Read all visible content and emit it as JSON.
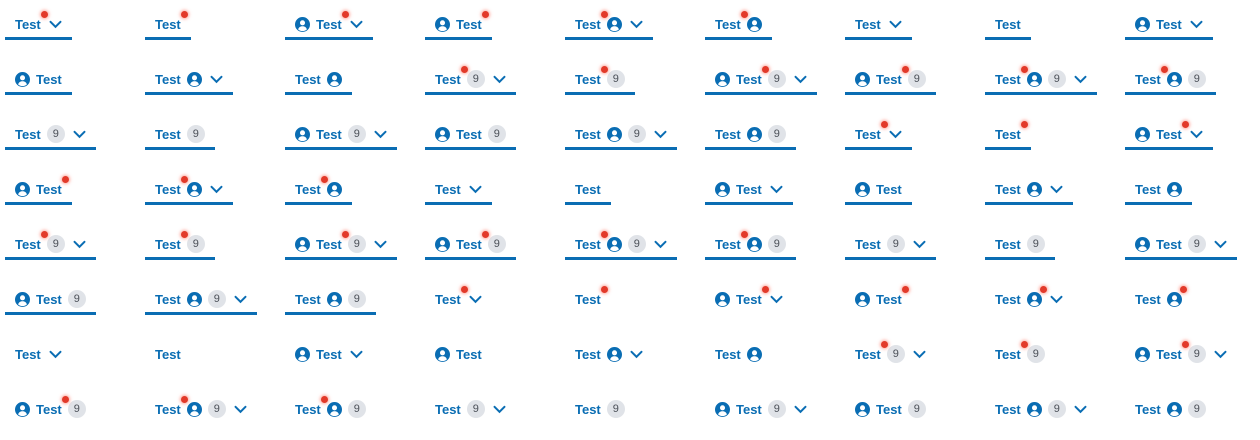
{
  "colors": {
    "accent": "#0a6db3",
    "dot": "#e23a2a",
    "badge_bg": "#e0e3e8",
    "badge_text": "#4a4f57"
  },
  "icons": {
    "avatar": "user-circle-icon",
    "dropdown": "chevron-down-icon",
    "notification": "notification-dot"
  },
  "rows": [
    [
      {
        "label": "Test",
        "selected": true,
        "dot": "label",
        "avatar": false,
        "badge": null,
        "chevron": true
      },
      {
        "label": "Test",
        "selected": true,
        "dot": "label",
        "avatar": false,
        "badge": null,
        "chevron": false
      },
      {
        "label": "Test",
        "selected": true,
        "dot": "label",
        "avatar": "before",
        "badge": null,
        "chevron": true
      },
      {
        "label": "Test",
        "selected": true,
        "dot": "label",
        "avatar": "before",
        "badge": null,
        "chevron": false
      },
      {
        "label": "Test",
        "selected": true,
        "dot": "label",
        "avatar": "after",
        "badge": null,
        "chevron": true
      },
      {
        "label": "Test",
        "selected": true,
        "dot": "label",
        "avatar": "after",
        "badge": null,
        "chevron": false
      },
      {
        "label": "Test",
        "selected": true,
        "dot": null,
        "avatar": false,
        "badge": null,
        "chevron": true
      },
      {
        "label": "Test",
        "selected": true,
        "dot": null,
        "avatar": false,
        "badge": null,
        "chevron": false
      },
      {
        "label": "Test",
        "selected": true,
        "dot": null,
        "avatar": "before",
        "badge": null,
        "chevron": true
      }
    ],
    [
      {
        "label": "Test",
        "selected": true,
        "dot": null,
        "avatar": "before",
        "badge": null,
        "chevron": false
      },
      {
        "label": "Test",
        "selected": true,
        "dot": null,
        "avatar": "after",
        "badge": null,
        "chevron": true
      },
      {
        "label": "Test",
        "selected": true,
        "dot": null,
        "avatar": "after",
        "badge": null,
        "chevron": false
      },
      {
        "label": "Test",
        "selected": true,
        "dot": "label",
        "avatar": false,
        "badge": "9",
        "chevron": true
      },
      {
        "label": "Test",
        "selected": true,
        "dot": "label",
        "avatar": false,
        "badge": "9",
        "chevron": false
      },
      {
        "label": "Test",
        "selected": true,
        "dot": "label",
        "avatar": "before",
        "badge": "9",
        "chevron": true
      },
      {
        "label": "Test",
        "selected": true,
        "dot": "label",
        "avatar": "before",
        "badge": "9",
        "chevron": false
      },
      {
        "label": "Test",
        "selected": true,
        "dot": "label",
        "avatar": "after",
        "badge": "9",
        "chevron": true
      },
      {
        "label": "Test",
        "selected": true,
        "dot": "label",
        "avatar": "after",
        "badge": "9",
        "chevron": false
      }
    ],
    [
      {
        "label": "Test",
        "selected": true,
        "dot": null,
        "avatar": false,
        "badge": "9",
        "chevron": true
      },
      {
        "label": "Test",
        "selected": true,
        "dot": null,
        "avatar": false,
        "badge": "9",
        "chevron": false
      },
      {
        "label": "Test",
        "selected": true,
        "dot": null,
        "avatar": "before",
        "badge": "9",
        "chevron": true
      },
      {
        "label": "Test",
        "selected": true,
        "dot": null,
        "avatar": "before",
        "badge": "9",
        "chevron": false
      },
      {
        "label": "Test",
        "selected": true,
        "dot": null,
        "avatar": "after",
        "badge": "9",
        "chevron": true
      },
      {
        "label": "Test",
        "selected": true,
        "dot": null,
        "avatar": "after",
        "badge": "9",
        "chevron": false
      },
      {
        "label": "Test",
        "selected": true,
        "dot": "label",
        "avatar": false,
        "badge": null,
        "chevron": true
      },
      {
        "label": "Test",
        "selected": true,
        "dot": "label",
        "avatar": false,
        "badge": null,
        "chevron": false
      },
      {
        "label": "Test",
        "selected": true,
        "dot": "label",
        "avatar": "before",
        "badge": null,
        "chevron": true
      }
    ],
    [
      {
        "label": "Test",
        "selected": true,
        "dot": "label",
        "avatar": "before",
        "badge": null,
        "chevron": false
      },
      {
        "label": "Test",
        "selected": true,
        "dot": "label",
        "avatar": "after",
        "badge": null,
        "chevron": true
      },
      {
        "label": "Test",
        "selected": true,
        "dot": "label",
        "avatar": "after",
        "badge": null,
        "chevron": false
      },
      {
        "label": "Test",
        "selected": true,
        "dot": null,
        "avatar": false,
        "badge": null,
        "chevron": true
      },
      {
        "label": "Test",
        "selected": true,
        "dot": null,
        "avatar": false,
        "badge": null,
        "chevron": false
      },
      {
        "label": "Test",
        "selected": true,
        "dot": null,
        "avatar": "before",
        "badge": null,
        "chevron": true
      },
      {
        "label": "Test",
        "selected": true,
        "dot": null,
        "avatar": "before",
        "badge": null,
        "chevron": false
      },
      {
        "label": "Test",
        "selected": true,
        "dot": null,
        "avatar": "after",
        "badge": null,
        "chevron": true
      },
      {
        "label": "Test",
        "selected": true,
        "dot": null,
        "avatar": "after",
        "badge": null,
        "chevron": false
      }
    ],
    [
      {
        "label": "Test",
        "selected": true,
        "dot": "label",
        "avatar": false,
        "badge": "9",
        "chevron": true
      },
      {
        "label": "Test",
        "selected": true,
        "dot": "label",
        "avatar": false,
        "badge": "9",
        "chevron": false
      },
      {
        "label": "Test",
        "selected": true,
        "dot": "label",
        "avatar": "before",
        "badge": "9",
        "chevron": true
      },
      {
        "label": "Test",
        "selected": true,
        "dot": "label",
        "avatar": "before",
        "badge": "9",
        "chevron": false
      },
      {
        "label": "Test",
        "selected": true,
        "dot": "label",
        "avatar": "after",
        "badge": "9",
        "chevron": true
      },
      {
        "label": "Test",
        "selected": true,
        "dot": "label",
        "avatar": "after",
        "badge": "9",
        "chevron": false
      },
      {
        "label": "Test",
        "selected": true,
        "dot": null,
        "avatar": false,
        "badge": "9",
        "chevron": true
      },
      {
        "label": "Test",
        "selected": true,
        "dot": null,
        "avatar": false,
        "badge": "9",
        "chevron": false
      },
      {
        "label": "Test",
        "selected": true,
        "dot": null,
        "avatar": "before",
        "badge": "9",
        "chevron": true
      }
    ],
    [
      {
        "label": "Test",
        "selected": true,
        "dot": null,
        "avatar": "before",
        "badge": "9",
        "chevron": false
      },
      {
        "label": "Test",
        "selected": true,
        "dot": null,
        "avatar": "after",
        "badge": "9",
        "chevron": true
      },
      {
        "label": "Test",
        "selected": true,
        "dot": null,
        "avatar": "after",
        "badge": "9",
        "chevron": false
      },
      {
        "label": "Test",
        "selected": false,
        "dot": "label",
        "avatar": false,
        "badge": null,
        "chevron": true
      },
      {
        "label": "Test",
        "selected": false,
        "dot": "label",
        "avatar": false,
        "badge": null,
        "chevron": false
      },
      {
        "label": "Test",
        "selected": false,
        "dot": "label",
        "avatar": "before",
        "badge": null,
        "chevron": true
      },
      {
        "label": "Test",
        "selected": false,
        "dot": "label",
        "avatar": "before",
        "badge": null,
        "chevron": false
      },
      {
        "label": "Test",
        "selected": false,
        "dot": "avatar",
        "avatar": "after",
        "badge": null,
        "chevron": true
      },
      {
        "label": "Test",
        "selected": false,
        "dot": "avatar",
        "avatar": "after",
        "badge": null,
        "chevron": false
      }
    ],
    [
      {
        "label": "Test",
        "selected": false,
        "dot": null,
        "avatar": false,
        "badge": null,
        "chevron": true
      },
      {
        "label": "Test",
        "selected": false,
        "dot": null,
        "avatar": false,
        "badge": null,
        "chevron": false
      },
      {
        "label": "Test",
        "selected": false,
        "dot": null,
        "avatar": "before",
        "badge": null,
        "chevron": true
      },
      {
        "label": "Test",
        "selected": false,
        "dot": null,
        "avatar": "before",
        "badge": null,
        "chevron": false
      },
      {
        "label": "Test",
        "selected": false,
        "dot": null,
        "avatar": "after",
        "badge": null,
        "chevron": true
      },
      {
        "label": "Test",
        "selected": false,
        "dot": null,
        "avatar": "after",
        "badge": null,
        "chevron": false
      },
      {
        "label": "Test",
        "selected": false,
        "dot": "label",
        "avatar": false,
        "badge": "9",
        "chevron": true
      },
      {
        "label": "Test",
        "selected": false,
        "dot": "label",
        "avatar": false,
        "badge": "9",
        "chevron": false
      },
      {
        "label": "Test",
        "selected": false,
        "dot": "label",
        "avatar": "before",
        "badge": "9",
        "chevron": true
      }
    ],
    [
      {
        "label": "Test",
        "selected": false,
        "dot": "label",
        "avatar": "before",
        "badge": "9",
        "chevron": false
      },
      {
        "label": "Test",
        "selected": false,
        "dot": "label",
        "avatar": "after",
        "badge": "9",
        "chevron": true
      },
      {
        "label": "Test",
        "selected": false,
        "dot": "label",
        "avatar": "after",
        "badge": "9",
        "chevron": false
      },
      {
        "label": "Test",
        "selected": false,
        "dot": null,
        "avatar": false,
        "badge": "9",
        "chevron": true
      },
      {
        "label": "Test",
        "selected": false,
        "dot": null,
        "avatar": false,
        "badge": "9",
        "chevron": false
      },
      {
        "label": "Test",
        "selected": false,
        "dot": null,
        "avatar": "before",
        "badge": "9",
        "chevron": true
      },
      {
        "label": "Test",
        "selected": false,
        "dot": null,
        "avatar": "before",
        "badge": "9",
        "chevron": false
      },
      {
        "label": "Test",
        "selected": false,
        "dot": null,
        "avatar": "after",
        "badge": "9",
        "chevron": true
      },
      {
        "label": "Test",
        "selected": false,
        "dot": null,
        "avatar": "after",
        "badge": "9",
        "chevron": false
      }
    ]
  ]
}
